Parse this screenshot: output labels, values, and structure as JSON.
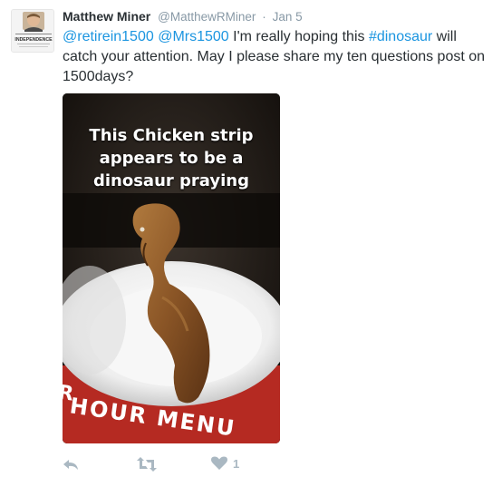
{
  "tweet": {
    "author_name": "Matthew Miner",
    "handle": "@MatthewRMiner",
    "separator": "·",
    "date": "Jan 5",
    "text_parts": {
      "mention1": "@retirein1500",
      "mention2": "@Mrs1500",
      "text1": " I'm really hoping this ",
      "hashtag": "#dinosaur",
      "text2": " will catch your attention. May I please share my ten questions post on 1500days?"
    },
    "media": {
      "caption_line1": "This Chicken strip",
      "caption_line2": "appears to be a",
      "caption_line3": "dinosaur praying",
      "sign_text": "HOUR MENU",
      "sign_text_top": "R"
    },
    "avatar_label": "INDEPENDENCE",
    "actions": {
      "like_count": "1"
    }
  },
  "colors": {
    "link": "#1b95e0",
    "muted": "#8899a6",
    "icon": "#aab8c2"
  },
  "icons": [
    "reply-icon",
    "retweet-icon",
    "heart-icon"
  ]
}
